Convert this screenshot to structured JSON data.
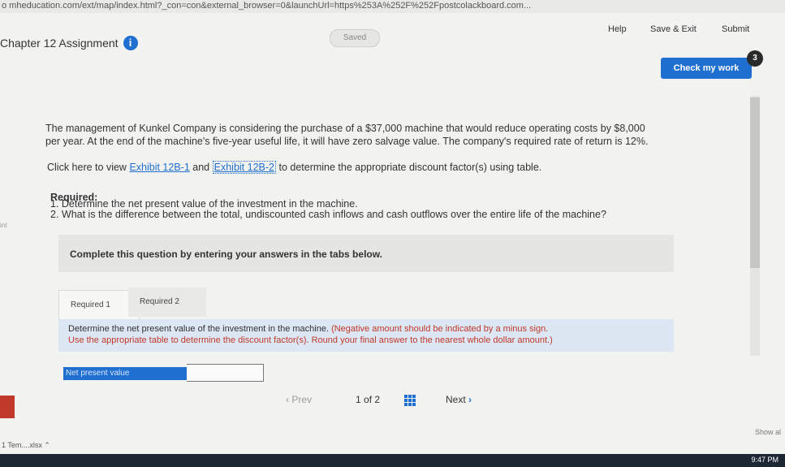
{
  "browser": {
    "url": "o mheducation.com/ext/map/index.html?_con=con&external_browser=0&launchUrl=https%253A%252F%252Fpostcolackboard.com..."
  },
  "header": {
    "chapter_title": "Chapter 12 Assignment",
    "saved_label": "Saved",
    "help_label": "Help",
    "save_exit_label": "Save & Exit",
    "submit_label": "Submit",
    "check_work_label": "Check my work",
    "check_badge": "3"
  },
  "problem": {
    "text_1": "The management of Kunkel Company is considering the purchase of a $37,000 machine that would reduce operating costs by $8,000",
    "text_2": "per year. At the end of the machine's five-year useful life, it will have zero salvage value. The company's required rate of return is 12%.",
    "click_prefix": "Click here to view",
    "exhibit_1": "Exhibit 12B-1",
    "and": "and",
    "exhibit_2": "Exhibit 12B-2",
    "click_suffix": "to determine the appropriate discount factor(s) using table.",
    "required_heading": "Required:",
    "req_1": "1. Determine the net present value of the investment in the machine.",
    "req_2": "2. What is the difference between the total, undiscounted cash inflows and cash outflows over the entire life of the machine?"
  },
  "instructions": "Complete this question by entering your answers in the tabs below.",
  "tabs": [
    {
      "label": "Required 1"
    },
    {
      "label": "Required 2"
    }
  ],
  "question": {
    "text": "Determine the net present value of the investment in the machine.",
    "note_1": "(Negative amount should be indicated by a minus sign.",
    "note_2": "Use the appropriate table to determine the discount factor(s). Round your final answer to the nearest whole dollar amount.)"
  },
  "answer": {
    "label": "Net present value",
    "value": ""
  },
  "pagination": {
    "prev_label": "Prev",
    "current": "1",
    "of": "of",
    "total": "2",
    "next_label": "Next"
  },
  "sidebar": {
    "small_text": "int"
  },
  "downloads": {
    "file_label": "1 Tem....xlsx",
    "show_all": "Show al"
  },
  "taskbar": {
    "time": "9:47 PM"
  },
  "colors": {
    "accent": "#1f6fd1",
    "note_red": "#c0392b"
  }
}
